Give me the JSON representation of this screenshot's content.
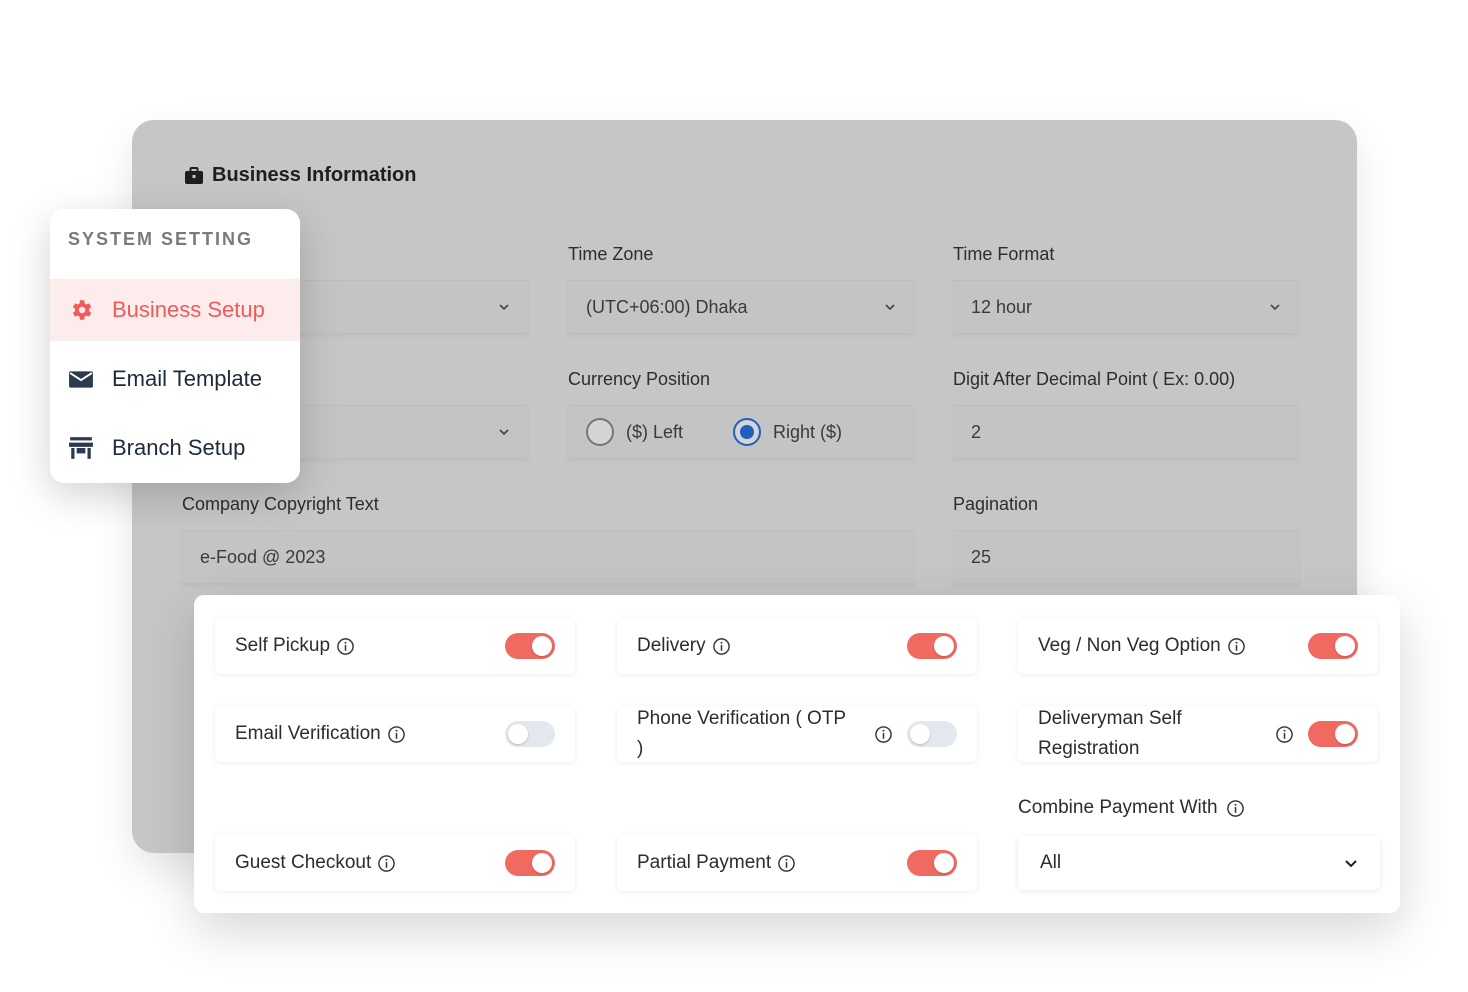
{
  "business_info": {
    "title": "Business Information",
    "time_zone": {
      "label": "Time Zone",
      "value": "(UTC+06:00) Dhaka"
    },
    "time_format": {
      "label": "Time Format",
      "value": "12 hour"
    },
    "currency_position": {
      "label": "Currency Position",
      "options": [
        "($) Left",
        "Right ($)"
      ],
      "selected": "Right ($)"
    },
    "decimal_point": {
      "label": "Digit After Decimal Point ( Ex: 0.00)",
      "value": "2"
    },
    "copyright": {
      "label": "Company Copyright Text",
      "value": "e-Food @ 2023"
    },
    "pagination": {
      "label": "Pagination",
      "value": "25"
    }
  },
  "menu": {
    "title": "SYSTEM SETTING",
    "items": [
      {
        "label": "Business Setup",
        "icon": "gear-icon",
        "active": true
      },
      {
        "label": "Email Template",
        "icon": "envelope-icon",
        "active": false
      },
      {
        "label": "Branch Setup",
        "icon": "store-icon",
        "active": false
      }
    ]
  },
  "settings": {
    "self_pickup": {
      "label": "Self Pickup",
      "enabled": true
    },
    "delivery": {
      "label": "Delivery",
      "enabled": true
    },
    "veg_nonveg": {
      "label": "Veg / Non Veg Option",
      "enabled": true
    },
    "email_verification": {
      "label": "Email Verification",
      "enabled": false
    },
    "phone_verification": {
      "label": "Phone Verification ( OTP )",
      "enabled": false
    },
    "deliveryman_self_registration": {
      "label": "Deliveryman Self Registration",
      "enabled": true
    },
    "guest_checkout": {
      "label": "Guest Checkout",
      "enabled": true
    },
    "partial_payment": {
      "label": "Partial Payment",
      "enabled": true
    },
    "combine_payment": {
      "label": "Combine Payment With",
      "value": "All"
    }
  },
  "colors": {
    "accent": "#f05a5a",
    "toggle_on": "#f06a62",
    "toggle_off": "#e3e8ee",
    "radio_selected": "#1f5fbf"
  }
}
